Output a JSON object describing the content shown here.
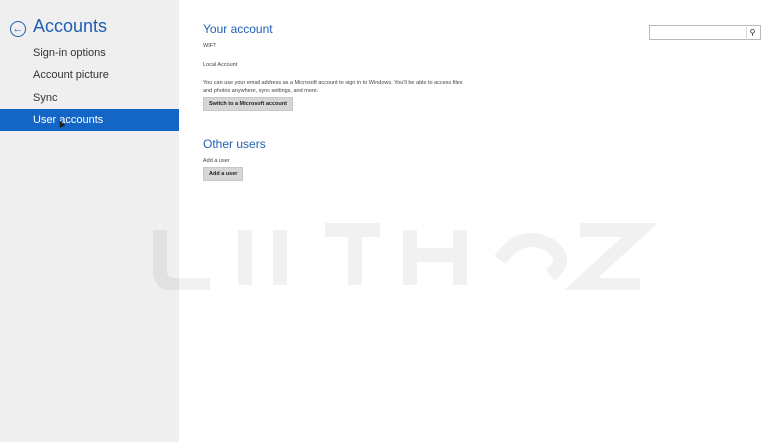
{
  "sidebar": {
    "title": "Accounts",
    "back_icon": "back-arrow-icon",
    "items": [
      {
        "label": "Sign-in options"
      },
      {
        "label": "Account picture"
      },
      {
        "label": "Sync"
      },
      {
        "label": "User accounts",
        "selected": true
      }
    ],
    "selected_color": "#1366c5"
  },
  "your_account": {
    "title": "Your account",
    "username": "WIFT",
    "account_type": "Local Account",
    "description": "You can use your email address as a Microsoft account to sign in to Windows. You'll be able to access files and photos anywhere, sync settings, and more.",
    "switch_button": "Switch to a Microsoft account"
  },
  "other_users": {
    "title": "Other users",
    "add_label": "Add a user",
    "add_button": "Add a user"
  },
  "search": {
    "placeholder": "",
    "icon": "search-icon"
  },
  "colors": {
    "accent": "#1f5fb4",
    "sidebar_bg": "#efefef"
  }
}
